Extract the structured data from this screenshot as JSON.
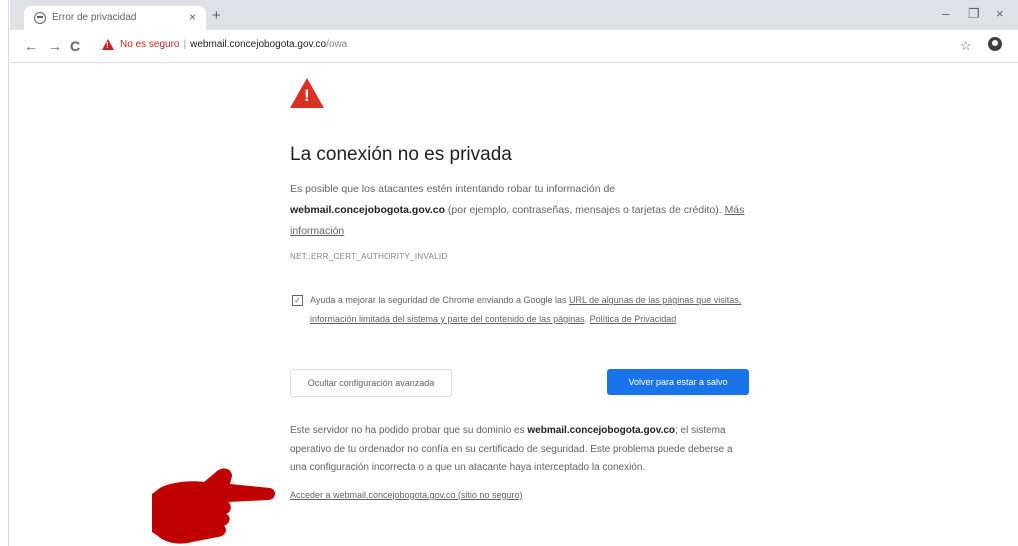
{
  "browser": {
    "tab_title": "Error de privacidad",
    "tab_close": "×",
    "new_tab": "+",
    "win_min": "–",
    "win_max": "❐",
    "win_close": "×",
    "nav_back": "←",
    "nav_forward": "→",
    "nav_reload": "C",
    "not_secure_label": "No es seguro",
    "separator": "|",
    "url_host": "webmail.concejobogota.gov.co",
    "url_path": "/owa",
    "star": "☆",
    "menu": "⋮"
  },
  "page": {
    "warning_mark": "!",
    "heading": "La conexión no es privada",
    "intro_before": "Es posible que los atacantes estén intentando robar tu información de ",
    "intro_host": "webmail.concejobogota.gov.co",
    "intro_after": " (por ejemplo, contraseñas, mensajes o tarjetas de crédito). ",
    "more_info": "Más información",
    "error_code": "NET::ERR_CERT_AUTHORITY_INVALID",
    "checkbox_mark": "✓",
    "optin_before": "Ayuda a mejorar la seguridad de Chrome enviando a Google las ",
    "optin_link": "URL de algunas de las páginas que visitas, información limitada del sistema y parte del contenido de las páginas",
    "optin_sep": ". ",
    "privacy_link": "Política de Privacidad",
    "btn_advanced": "Ocultar configuración avanzada",
    "btn_back": "Volver para estar a salvo",
    "details_before": "Este servidor no ha podido probar que su dominio es ",
    "details_host": "webmail.concejobogota.gov.co",
    "details_after": "; el sistema operativo de tu ordenador no confía en su certificado de seguridad. Este problema puede deberse a una configuración incorrecta o a que un atacante haya interceptado la conexión.",
    "proceed_link": "Acceder a webmail.concejobogota.gov.co (sitio no seguro)"
  },
  "colors": {
    "danger": "#d93025",
    "primary": "#1a73e8",
    "annotation_hand": "#c00000"
  }
}
